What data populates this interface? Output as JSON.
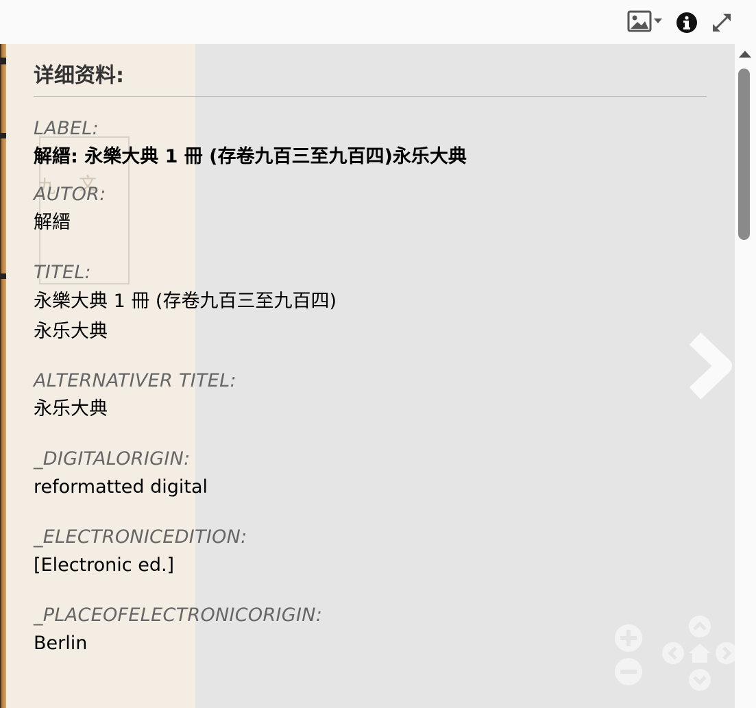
{
  "toolbar": {
    "icons": [
      "image-icon",
      "info-icon",
      "fullscreen-icon"
    ]
  },
  "panel": {
    "title": "详细资料:",
    "fields": [
      {
        "label": "LABEL:",
        "value": "解縉: 永樂大典 1 冊 (存卷九百三至九百四)永乐大典"
      },
      {
        "label": "AUTOR:",
        "value": "解縉"
      },
      {
        "label": "TITEL:",
        "value_line1": "永樂大典 1 冊 (存卷九百三至九百四)",
        "value_line2": "永乐大典"
      },
      {
        "label": "ALTERNATIVER TITEL:",
        "value": "永乐大典"
      },
      {
        "label": "_DIGITALORIGIN:",
        "value": "reformatted digital"
      },
      {
        "label": "_ELECTRONICEDITION:",
        "value": "[Electronic ed.]"
      },
      {
        "label": "_PLACEOFELECTRONICORIGIN:",
        "value": "Berlin"
      }
    ]
  },
  "viewer": {
    "scan_glyphs": [
      "九",
      "文"
    ]
  },
  "colors": {
    "background": "#e5e5e5",
    "label": "#666666",
    "title": "#333333",
    "toolbar_icon": "#444444"
  }
}
